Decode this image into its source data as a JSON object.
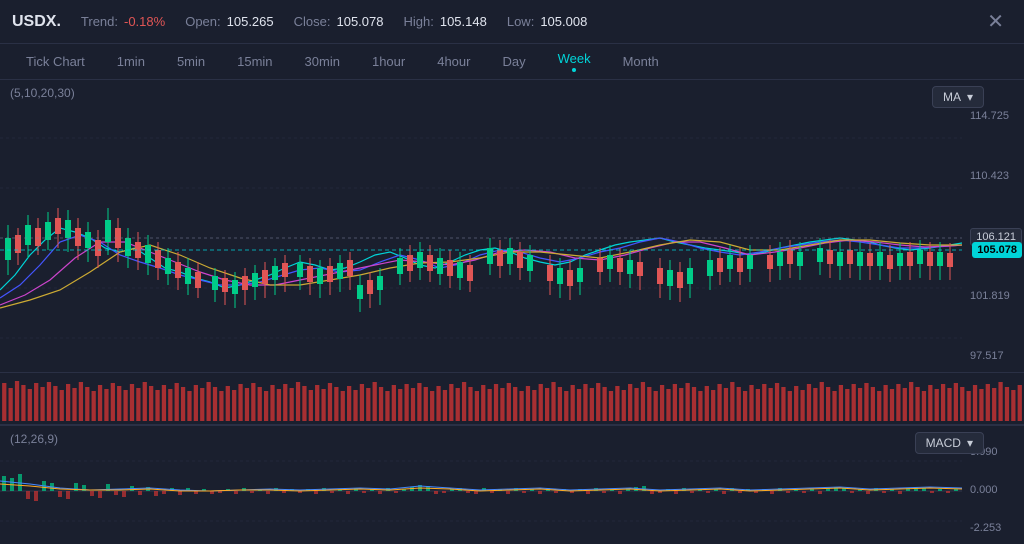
{
  "header": {
    "symbol": "USDX.",
    "trend_label": "Trend:",
    "trend_value": "-0.18%",
    "open_label": "Open:",
    "open_value": "105.265",
    "close_label": "Close:",
    "close_value": "105.078",
    "high_label": "High:",
    "high_value": "105.148",
    "low_label": "Low:",
    "low_value": "105.008",
    "close_icon": "✕"
  },
  "timeframes": [
    {
      "label": "Tick Chart",
      "active": false
    },
    {
      "label": "1min",
      "active": false
    },
    {
      "label": "5min",
      "active": false
    },
    {
      "label": "15min",
      "active": false
    },
    {
      "label": "30min",
      "active": false
    },
    {
      "label": "1hour",
      "active": false
    },
    {
      "label": "4hour",
      "active": false
    },
    {
      "label": "Day",
      "active": false
    },
    {
      "label": "Week",
      "active": true
    },
    {
      "label": "Month",
      "active": false
    }
  ],
  "chart": {
    "ma_label": "(5,10,20,30)",
    "ma_selector": "MA",
    "price_levels": [
      "114.725",
      "110.423",
      "106.121",
      "101.819",
      "97.517"
    ],
    "current_price": "105.078",
    "above_price": "106.121"
  },
  "macd": {
    "label": "(12,26,9)",
    "selector": "MACD",
    "levels": [
      "3.090",
      "0.000",
      "-2.253"
    ]
  }
}
